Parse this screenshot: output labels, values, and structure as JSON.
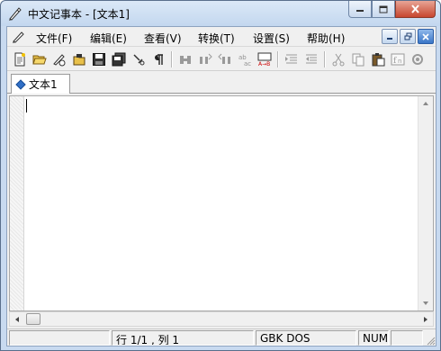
{
  "window": {
    "title": "中文记事本 - [文本1]"
  },
  "menubar": {
    "items": [
      {
        "label": "文件(F)"
      },
      {
        "label": "编辑(E)"
      },
      {
        "label": "查看(V)"
      },
      {
        "label": "转换(T)"
      },
      {
        "label": "设置(S)"
      },
      {
        "label": "帮助(H)"
      }
    ]
  },
  "toolbar": {
    "buttons": [
      {
        "icon": "new-file-icon"
      },
      {
        "icon": "open-folder-icon"
      },
      {
        "icon": "open-recent-icon"
      },
      {
        "icon": "unlock-open-icon"
      },
      {
        "icon": "save-icon"
      },
      {
        "icon": "save-all-icon"
      },
      {
        "icon": "tools-icon"
      },
      {
        "icon": "paragraph-icon"
      },
      {
        "icon": "find-icon"
      },
      {
        "icon": "find-next-icon"
      },
      {
        "icon": "find-prev-icon"
      },
      {
        "icon": "replace-icon"
      },
      {
        "icon": "convert-ab-icon"
      },
      {
        "icon": "indent-icon"
      },
      {
        "icon": "outdent-icon"
      },
      {
        "icon": "cut-icon"
      },
      {
        "icon": "copy-icon"
      },
      {
        "icon": "paste-icon"
      },
      {
        "icon": "font-icon"
      },
      {
        "icon": "settings-icon"
      }
    ]
  },
  "tabs": [
    {
      "label": "文本1"
    }
  ],
  "editor": {
    "content": ""
  },
  "statusbar": {
    "position": "行 1/1 , 列 1",
    "encoding": "GBK  DOS",
    "numlock": "NUM"
  },
  "colors": {
    "titlebar": "#c3d7ef",
    "close_button": "#c7462f",
    "tab_marker": "#2f6fc7"
  }
}
